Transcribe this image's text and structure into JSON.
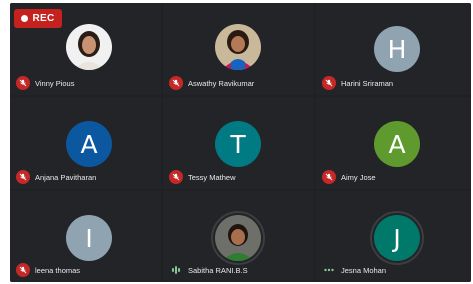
{
  "recording": {
    "label": "REC"
  },
  "participants": [
    {
      "name": "Vinny Pious",
      "avatar_letter": "",
      "avatar_color": "",
      "photo": true,
      "status": "muted"
    },
    {
      "name": "Aswathy Ravikumar",
      "avatar_letter": "",
      "avatar_color": "",
      "photo": true,
      "status": "muted"
    },
    {
      "name": "Harini Sriraman",
      "avatar_letter": "H",
      "avatar_color": "#8fa3b0",
      "photo": false,
      "status": "muted"
    },
    {
      "name": "Anjana Pavitharan",
      "avatar_letter": "A",
      "avatar_color": "#0b57a0",
      "photo": false,
      "status": "muted"
    },
    {
      "name": "Tessy Mathew",
      "avatar_letter": "T",
      "avatar_color": "#007b83",
      "photo": false,
      "status": "muted"
    },
    {
      "name": "Aimy Jose",
      "avatar_letter": "A",
      "avatar_color": "#5f9a2e",
      "photo": false,
      "status": "muted"
    },
    {
      "name": "leena thomas",
      "avatar_letter": "I",
      "avatar_color": "#8fa3b0",
      "photo": false,
      "status": "muted"
    },
    {
      "name": "Sabitha RANI.B.S",
      "avatar_letter": "",
      "avatar_color": "",
      "photo": true,
      "status": "speaking"
    },
    {
      "name": "Jesna Mohan",
      "avatar_letter": "J",
      "avatar_color": "#00796b",
      "photo": false,
      "status": "idle"
    }
  ],
  "colors": {
    "background": "#202124",
    "tile": "#232428",
    "mute": "#c62828",
    "rec": "#c5221f"
  }
}
